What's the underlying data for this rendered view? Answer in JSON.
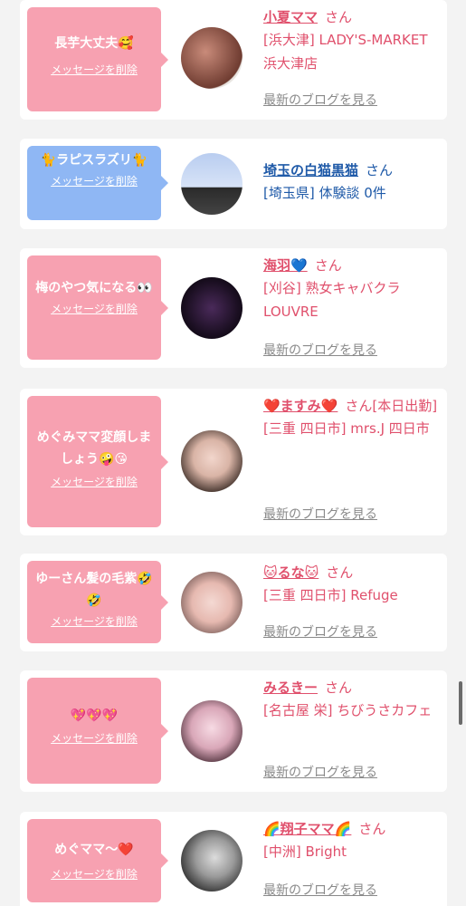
{
  "favorites": [
    {
      "bubble_color": "pink",
      "message": "長芋大丈夫🥰",
      "delete_label": "メッセージを削除",
      "user": "小夏ママ",
      "honorific": "さん",
      "shop": "[浜大津] LADY'S-MARKET 浜大津店",
      "blog_link": "最新のブログを見る"
    },
    {
      "bubble_color": "blue",
      "message": "🐈ラピスラズリ🐈",
      "delete_label": "メッセージを削除",
      "user": "埼玉の白猫黒猫",
      "honorific": "さん",
      "shop": "[埼玉県] 体験談 0件",
      "blog_link": ""
    },
    {
      "bubble_color": "pink",
      "message": "梅のやつ気になる👀",
      "delete_label": "メッセージを削除",
      "user": "海羽💙",
      "honorific": "さん",
      "shop": "[刈谷] 熟女キャバクラLOUVRE",
      "blog_link": "最新のブログを見る"
    },
    {
      "bubble_color": "pink",
      "message": "めぐみママ変顔しましょう🤪😘",
      "delete_label": "メッセージを削除",
      "user": "❤️ますみ❤️",
      "honorific": "さん[本日出勤]",
      "shop": "[三重 四日市] mrs.J 四日市",
      "blog_link": "最新のブログを見る"
    },
    {
      "bubble_color": "pink",
      "message": "ゆーさん髪の毛紫🤣🤣",
      "delete_label": "メッセージを削除",
      "user": "🐱るな🐱",
      "honorific": "さん",
      "shop": "[三重 四日市] Refuge",
      "blog_link": "最新のブログを見る"
    },
    {
      "bubble_color": "pink",
      "message": "💖💖💖",
      "delete_label": "メッセージを削除",
      "user": "みるきー",
      "honorific": "さん",
      "shop": "[名古屋 栄] ちびうさカフェ",
      "blog_link": "最新のブログを見る"
    },
    {
      "bubble_color": "pink",
      "message": "めぐママ〜❤️",
      "delete_label": "メッセージを削除",
      "user": "🌈翔子ママ🌈",
      "honorific": "さん",
      "shop": "[中洲] Bright",
      "blog_link": "最新のブログを見る"
    }
  ],
  "colors": {
    "accent": "#e0506c",
    "bubble_pink": "#f7a1b1",
    "bubble_blue": "#8fb7f4",
    "link_blue": "#1f5aa8"
  }
}
